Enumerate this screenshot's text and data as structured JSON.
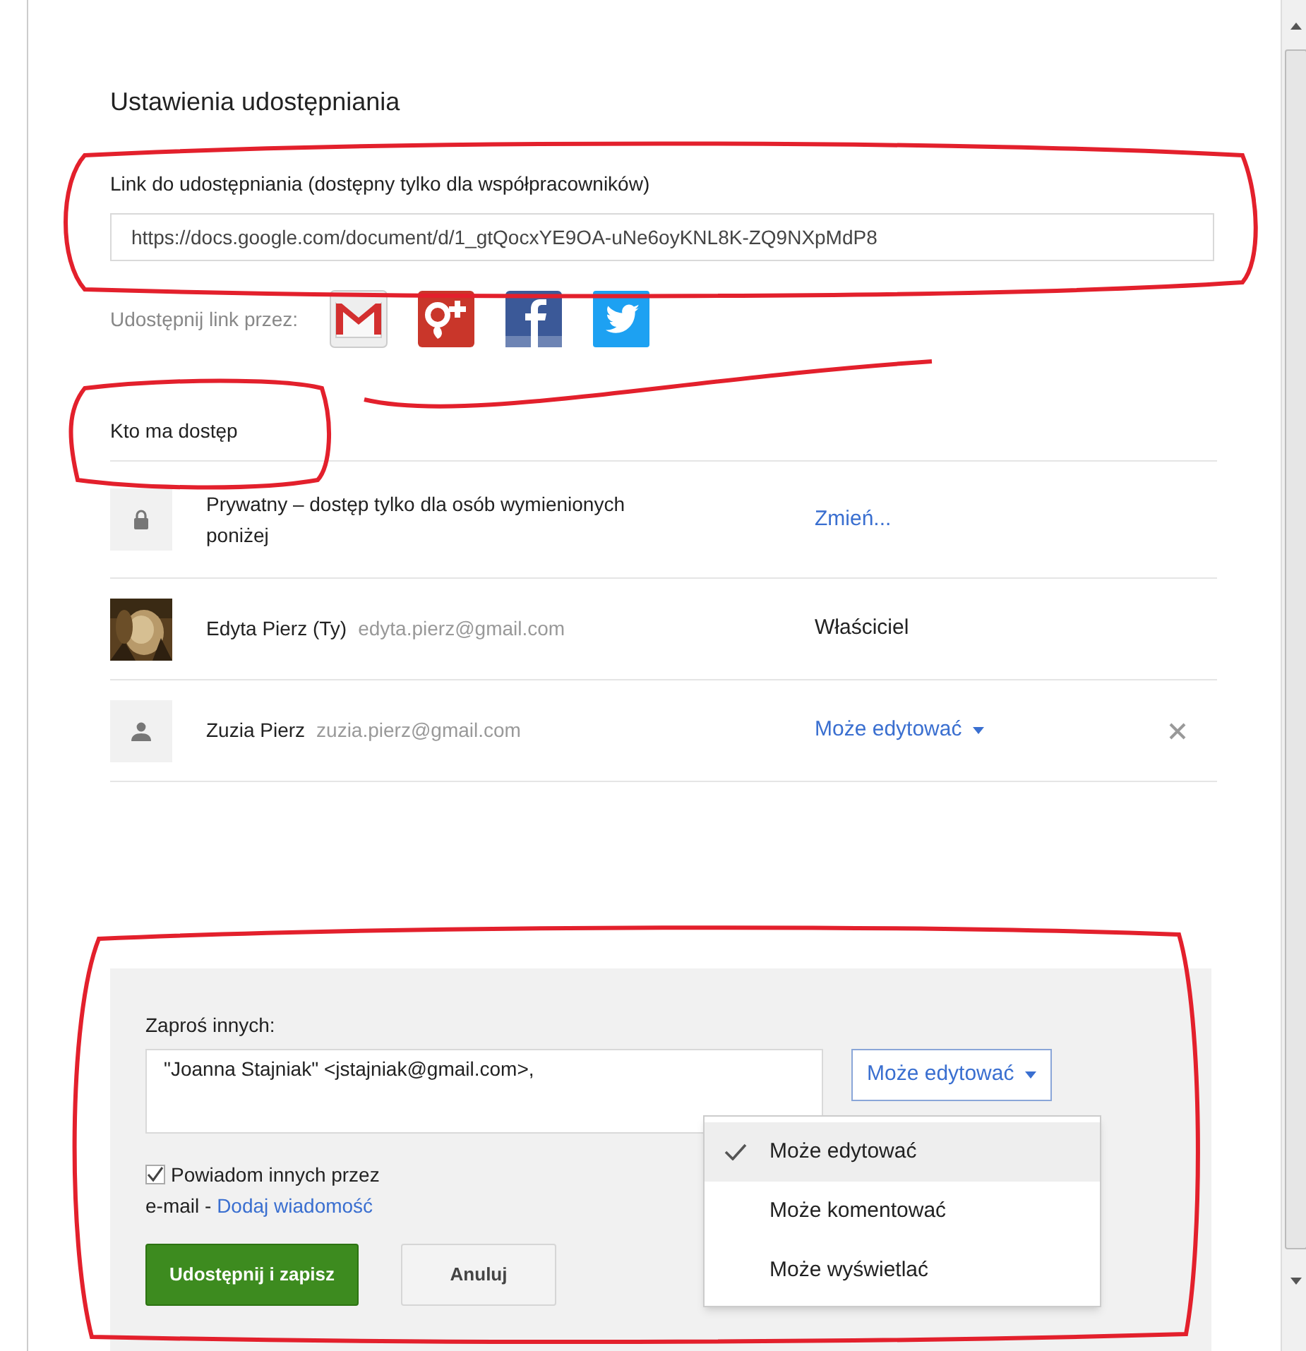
{
  "title": "Ustawienia udostępniania",
  "link": {
    "label": "Link do udostępniania (dostępny tylko dla współpracowników)",
    "value": "https://docs.google.com/document/d/1_gtQocxYE9OA-uNe6oyKNL8K-ZQ9NXpMdP8"
  },
  "share_via": {
    "label": "Udostępnij link przez:",
    "services": [
      {
        "kind": "gmail"
      },
      {
        "kind": "gplus"
      },
      {
        "kind": "facebook"
      },
      {
        "kind": "twitter"
      }
    ]
  },
  "access": {
    "title": "Kto ma dostęp",
    "rows": [
      {
        "kind": "visibility",
        "text": "Prywatny – dostęp tylko dla osób wymienionych poniżej",
        "action": "Zmień..."
      },
      {
        "kind": "owner",
        "name": "Edyta Pierz (Ty)",
        "email": "edyta.pierz@gmail.com",
        "role": "Właściciel"
      },
      {
        "kind": "person",
        "name": "Zuzia Pierz",
        "email": "zuzia.pierz@gmail.com",
        "role": "Może edytować",
        "removable": true
      }
    ]
  },
  "invite": {
    "label": "Zaproś innych:",
    "value": "\"Joanna Stajniak\" <jstajniak@gmail.com>,",
    "permission": "Może edytować",
    "menu": [
      {
        "label": "Może edytować",
        "selected": true
      },
      {
        "label": "Może komentować",
        "selected": false
      },
      {
        "label": "Może wyświetlać",
        "selected": false
      }
    ],
    "notify": {
      "checked": true,
      "line1": "Powiadom innych przez",
      "line2": "e-mail - ",
      "link": "Dodaj wiadomość"
    },
    "buttons": [
      {
        "kind": "primary",
        "label": "Udostępnij i zapisz"
      },
      {
        "kind": "secondary",
        "label": "Anuluj"
      }
    ]
  }
}
